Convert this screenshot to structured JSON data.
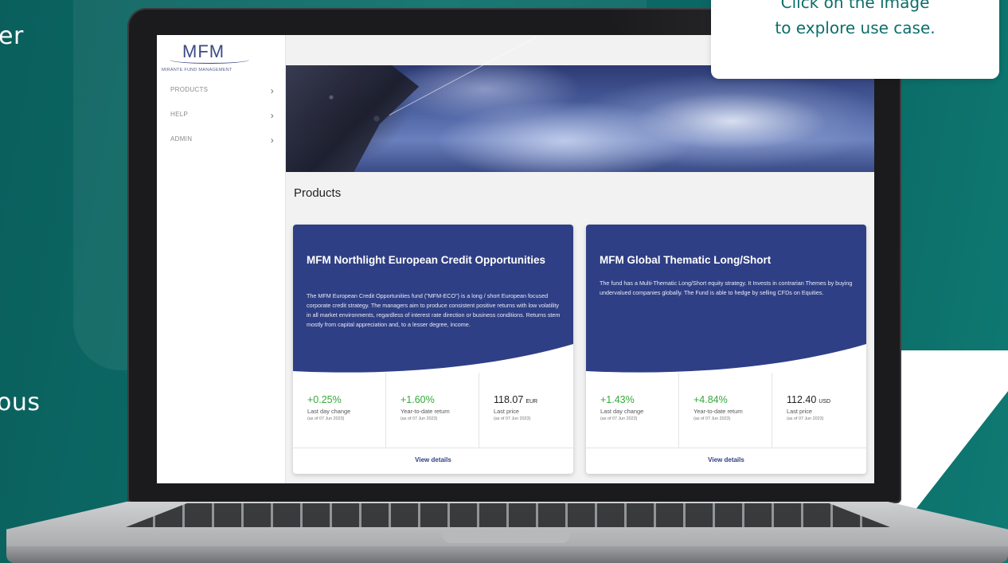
{
  "background": {
    "accent_color": "#0c6e6a",
    "side_text_top": "er",
    "side_text_bottom": "ous"
  },
  "tooltip": {
    "line1": "Click on the image",
    "line2": "to explore use case."
  },
  "app": {
    "logo_text": "MFM",
    "logo_subtitle": "MIRANTE FUND MANAGEMENT",
    "brand_color": "#2f3f85"
  },
  "sidebar": {
    "items": [
      {
        "label": "PRODUCTS",
        "icon": "chevron-right-icon"
      },
      {
        "label": "HELP",
        "icon": "chevron-right-icon"
      },
      {
        "label": "ADMIN",
        "icon": "chevron-right-icon"
      }
    ]
  },
  "main": {
    "page_title": "Products",
    "products": [
      {
        "title": "MFM Northlight European Credit Opportunities",
        "description": "The MFM European Credit Opportunities fund (\"MFM-ECO\") is a long / short European focused corporate credit strategy. The managers aim to produce consistent positive returns with low volatility in all market environments, regardless of interest rate direction or business conditions. Returns stem mostly from capital appreciation and, to a lesser degree, income.",
        "stats": [
          {
            "value": "+0.25%",
            "label": "Last day change",
            "asof": "(as of 07 Jun 2023)"
          },
          {
            "value": "+1.60%",
            "label": "Year-to-date return",
            "asof": "(as of 07 Jun 2023)"
          },
          {
            "value": "118.07",
            "currency": "EUR",
            "label": "Last price",
            "asof": "(as of 07 Jun 2023)"
          }
        ],
        "action": "View details"
      },
      {
        "title": "MFM Global Thematic Long/Short",
        "description": "The fund has a Multi-Thematic Long/Short equity strategy. It Invests in contrarian Themes by buying undervalued companies globally. The Fund is able to hedge by selling CFDs on Equities.",
        "stats": [
          {
            "value": "+1.43%",
            "label": "Last day change",
            "asof": "(as of 07 Jun 2023)"
          },
          {
            "value": "+4.84%",
            "label": "Year-to-date return",
            "asof": "(as of 07 Jun 2023)"
          },
          {
            "value": "112.40",
            "currency": "USD",
            "label": "Last price",
            "asof": "(as of 07 Jun 2023)"
          }
        ],
        "action": "View details"
      }
    ]
  }
}
